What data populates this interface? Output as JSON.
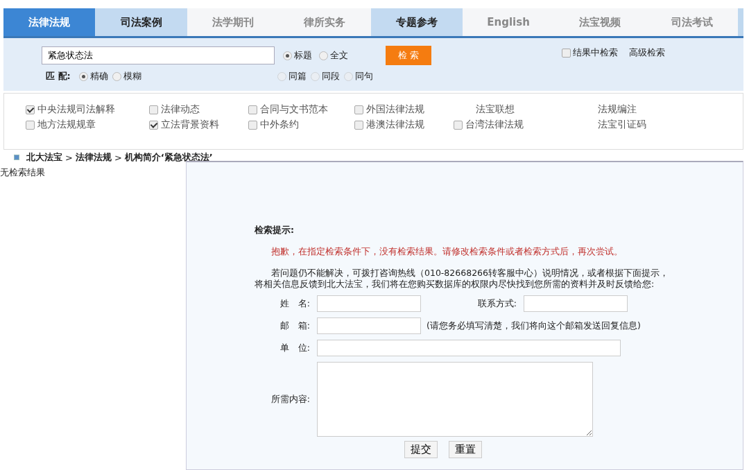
{
  "tabs": [
    {
      "label": "法律法规",
      "selected": true
    },
    {
      "label": "司法案例",
      "selected": false,
      "featured": true
    },
    {
      "label": "法学期刊",
      "selected": false,
      "featured": false
    },
    {
      "label": "律所实务",
      "selected": false,
      "featured": false
    },
    {
      "label": "专题参考",
      "selected": false,
      "featured": true
    },
    {
      "label": "English",
      "selected": false,
      "featured": false
    },
    {
      "label": "法宝视频",
      "selected": false,
      "featured": false
    },
    {
      "label": "司法考试",
      "selected": false,
      "featured": false
    }
  ],
  "search": {
    "value": "紧急状态法",
    "button": "检 索",
    "field_options": [
      {
        "label": "标题",
        "selected": true
      },
      {
        "label": "全文",
        "selected": false
      }
    ],
    "match_label": "匹 配:",
    "match_options": [
      {
        "label": "精确",
        "selected": true
      },
      {
        "label": "模糊",
        "selected": false
      }
    ],
    "scope_options": [
      {
        "label": "同篇",
        "selected": false,
        "disabled": true
      },
      {
        "label": "同段",
        "selected": false,
        "disabled": true
      },
      {
        "label": "同句",
        "selected": false,
        "disabled": true
      }
    ],
    "within_results": {
      "label": "结果中检索",
      "checked": false
    },
    "advanced_link": "高级检索"
  },
  "databases": [
    {
      "kind": "checkbox",
      "label": "中央法规司法解释",
      "checked": true
    },
    {
      "kind": "checkbox",
      "label": "法律动态",
      "checked": false
    },
    {
      "kind": "checkbox",
      "label": "合同与文书范本",
      "checked": false
    },
    {
      "kind": "checkbox",
      "label": "外国法律法规",
      "checked": false
    },
    {
      "kind": "link",
      "label": "法宝联想"
    },
    {
      "kind": "link",
      "label": "法规编注"
    },
    {
      "kind": "checkbox",
      "label": "地方法规规章",
      "checked": false
    },
    {
      "kind": "checkbox",
      "label": "立法背景资料",
      "checked": true
    },
    {
      "kind": "checkbox",
      "label": "中外条约",
      "checked": false
    },
    {
      "kind": "checkbox",
      "label": "港澳法律法规",
      "checked": false
    },
    {
      "kind": "checkbox",
      "label": "台湾法律法规",
      "checked": false
    },
    {
      "kind": "link",
      "label": "法宝引证码"
    }
  ],
  "breadcrumb": [
    "北大法宝",
    "法律法规",
    "机构简介‘紧急状态法’"
  ],
  "breadcrumb_separator": ">",
  "left_message": "无检索结果",
  "help": {
    "title": "检索提示:",
    "error": "抱歉，在指定检索条件下，没有检索结果。请修改检索条件或者检索方式后，再次尝试。",
    "paragraph": "若问题仍不能解决，可拨打咨询热线（010-82668266转客服中心）说明情况，或者根据下面提示，将相关信息反馈到北大法宝，我们将在您购买数据库的权限内尽快找到您所需的资料并及时反馈给您:",
    "name_label": "姓　名:",
    "contact_label": "联系方式:",
    "email_label": "邮　箱:",
    "email_note": "(请您务必填写清楚，我们将向这个邮箱发送回复信息)",
    "unit_label": "单　位:",
    "content_label": "所需内容:",
    "submit": "提交",
    "reset": "重置"
  }
}
